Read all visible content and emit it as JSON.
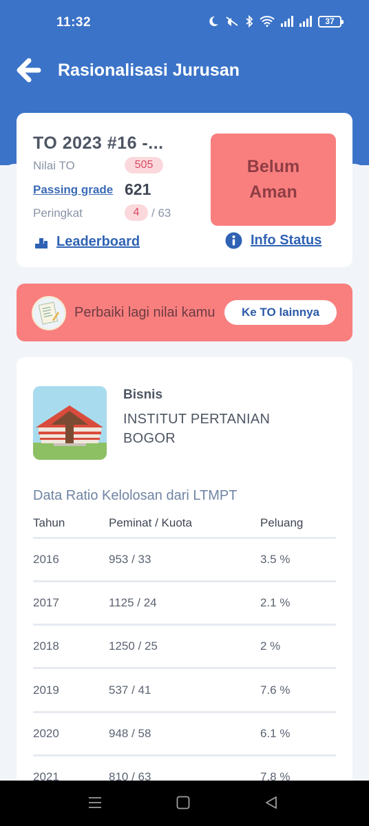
{
  "status_bar": {
    "time": "11:32",
    "battery": "37"
  },
  "app_bar": {
    "title": "Rasionalisasi Jurusan"
  },
  "summary": {
    "to_title": "TO 2023 #16 -...",
    "nilai_label": "Nilai TO",
    "nilai_value": "505",
    "passing_grade_label": "Passing grade",
    "passing_grade_value": "621",
    "peringkat_label": "Peringkat",
    "peringkat_value": "4",
    "peringkat_total": "/ 63",
    "status_line1": "Belum",
    "status_line2": "Aman",
    "leaderboard_label": "Leaderboard",
    "info_status_label": "Info Status"
  },
  "banner": {
    "text": "Perbaiki lagi nilai kamu",
    "button": "Ke TO lainnya"
  },
  "detail": {
    "major": "Bisnis",
    "university_line1": "INSTITUT PERTANIAN",
    "university_line2": "BOGOR",
    "ratio_title": "Data Ratio Kelolosan dari LTMPT",
    "columns": [
      "Tahun",
      "Peminat / Kuota",
      "Peluang"
    ],
    "rows": [
      [
        "2016",
        "953 / 33",
        "3.5 %"
      ],
      [
        "2017",
        "1125 / 24",
        "2.1 %"
      ],
      [
        "2018",
        "1250 / 25",
        "2 %"
      ],
      [
        "2019",
        "537 / 41",
        "7.6 %"
      ],
      [
        "2020",
        "948 / 58",
        "6.1 %"
      ],
      [
        "2021",
        "810 / 63",
        "7.8 %"
      ]
    ]
  },
  "colors": {
    "header_blue": "#3b73c8",
    "status_red": "#f97f7f",
    "pill_pink": "#fbd8dc",
    "link_blue": "#2f62b4"
  },
  "icons": [
    "moon-icon",
    "mute-icon",
    "bluetooth-icon",
    "wifi-icon",
    "signal-icon",
    "battery-icon",
    "back-arrow-icon",
    "leaderboard-icon",
    "info-icon",
    "exam-paper-icon",
    "menu-nav-icon",
    "home-nav-icon",
    "back-nav-icon"
  ]
}
